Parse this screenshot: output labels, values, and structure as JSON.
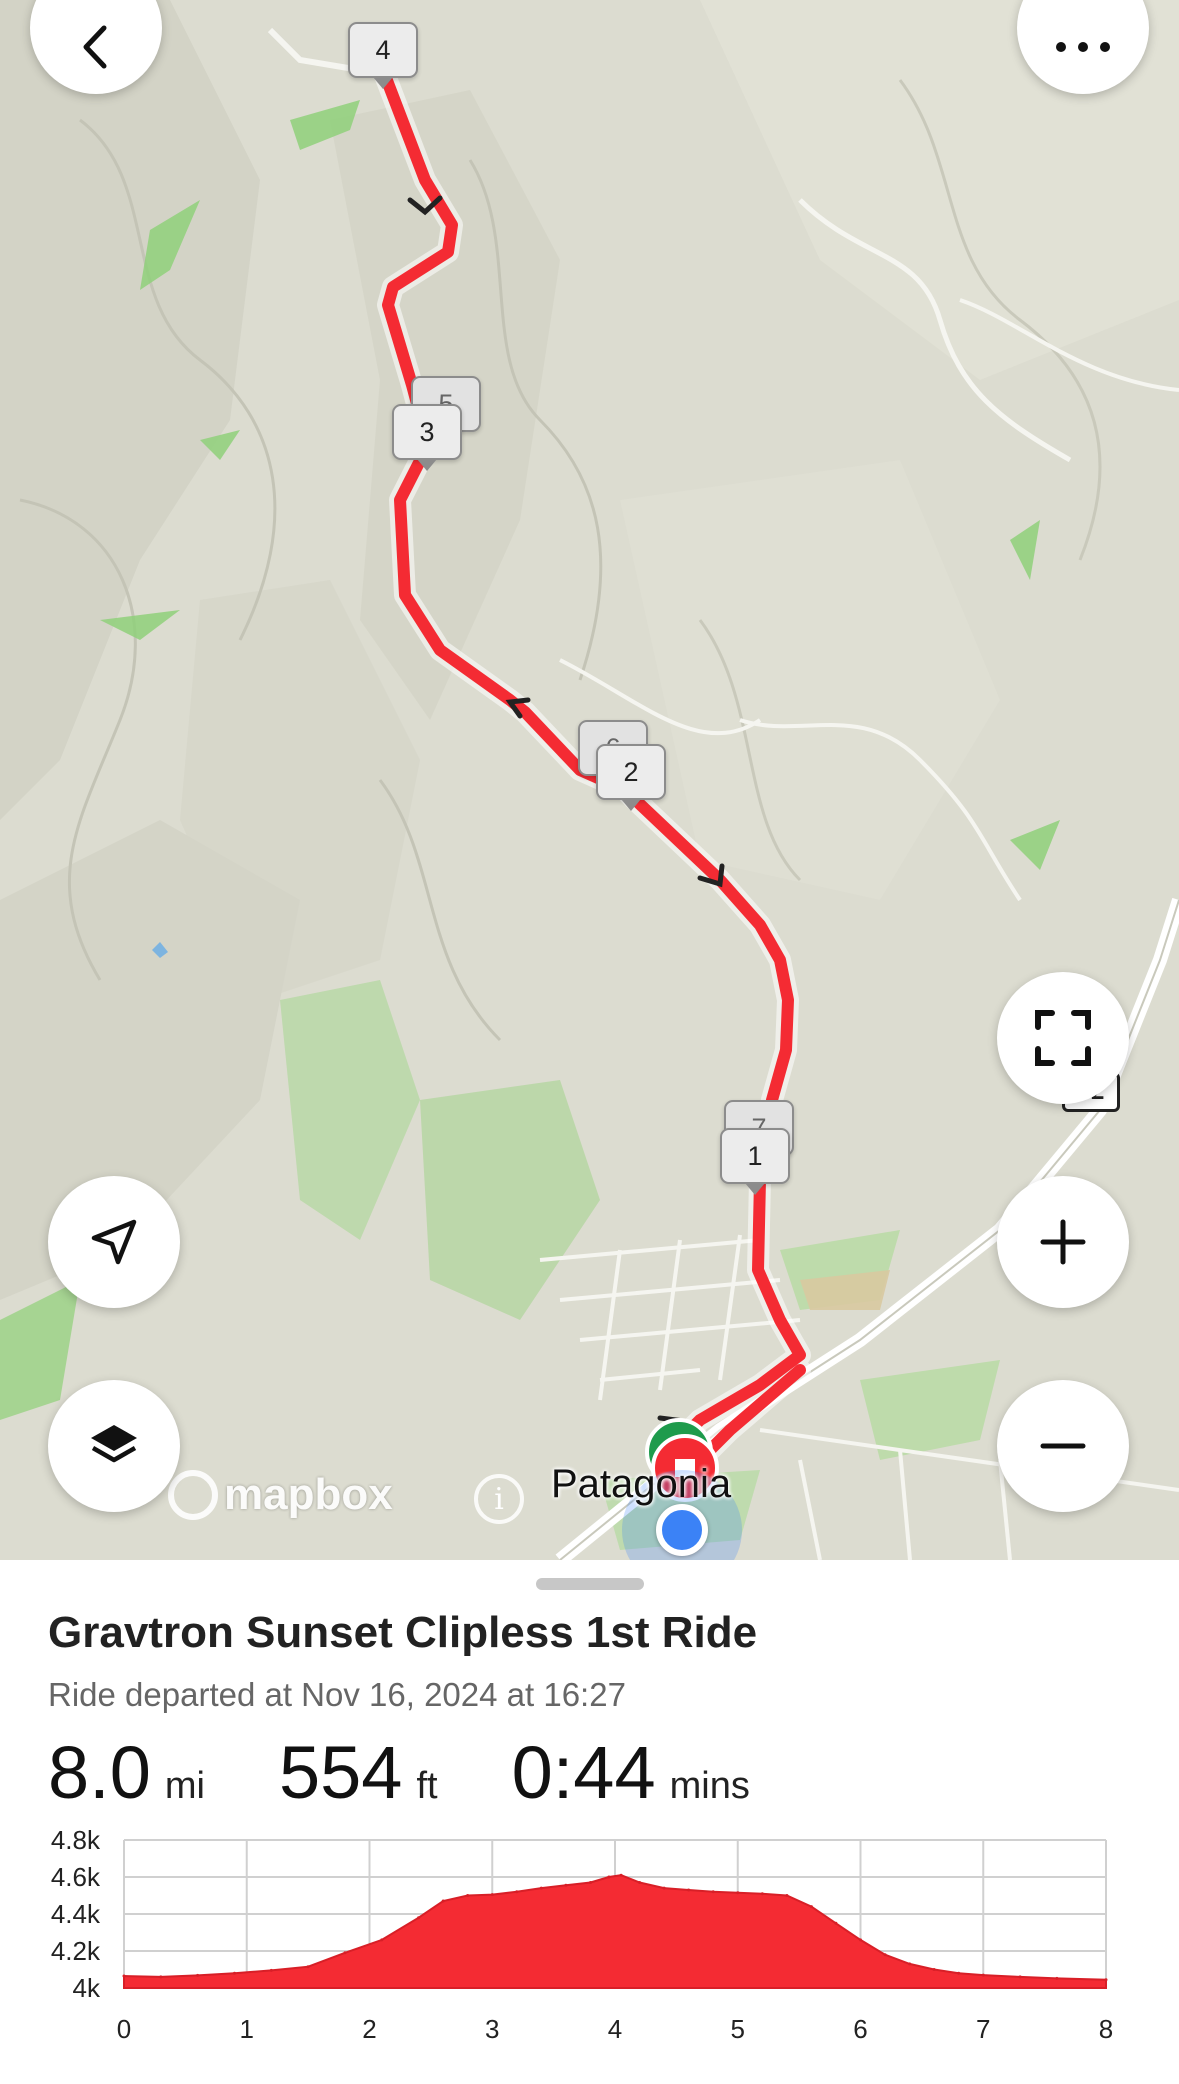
{
  "map": {
    "place_label": "Patagonia",
    "attribution_logo": "mapbox",
    "route_color": "#f42b33",
    "start_color": "#1e9b4c",
    "location_color": "#3b82f6",
    "route_markers": [
      {
        "label": "4"
      },
      {
        "label": "5"
      },
      {
        "label": "3"
      },
      {
        "label": "6"
      },
      {
        "label": "2"
      },
      {
        "label": "7"
      },
      {
        "label": "1"
      }
    ],
    "highway_shield": "82",
    "controls": {
      "back_icon": "chevron-left-icon",
      "more_icon": "ellipsis-icon",
      "fullscreen_icon": "expand-icon",
      "zoom_in_icon": "plus-icon",
      "zoom_out_icon": "minus-icon",
      "locate_icon": "navigation-arrow-icon",
      "layers_icon": "layers-icon",
      "info_icon": "info-icon"
    }
  },
  "ride": {
    "title": "Gravtron Sunset Clipless 1st Ride",
    "departed": "Ride departed at Nov 16, 2024 at 16:27",
    "stats": [
      {
        "value": "8.0",
        "unit": "mi"
      },
      {
        "value": "554",
        "unit": "ft"
      },
      {
        "value": "0:44",
        "unit": "mins"
      }
    ]
  },
  "chart_data": {
    "type": "area",
    "title": "",
    "xlabel": "",
    "ylabel": "",
    "x_ticks": [
      "0",
      "1",
      "2",
      "3",
      "4",
      "5",
      "6",
      "7",
      "8"
    ],
    "y_ticks": [
      "4k",
      "4.2k",
      "4.4k",
      "4.6k",
      "4.8k"
    ],
    "xlim": [
      0,
      8
    ],
    "ylim": [
      4000,
      4800
    ],
    "grid": true,
    "color": "#f42b33",
    "series": [
      {
        "x": [
          0,
          0.3,
          0.6,
          0.9,
          1.2,
          1.5,
          1.8,
          2.1,
          2.4,
          2.6,
          2.8,
          3.0,
          3.2,
          3.4,
          3.6,
          3.8,
          3.95,
          4.05,
          4.2,
          4.4,
          4.6,
          4.8,
          5.0,
          5.2,
          5.4,
          5.6,
          5.8,
          6.0,
          6.2,
          6.4,
          6.6,
          6.8,
          7.0,
          7.3,
          7.6,
          8.0
        ],
        "y": [
          4065,
          4060,
          4068,
          4080,
          4095,
          4115,
          4190,
          4260,
          4380,
          4470,
          4500,
          4505,
          4520,
          4540,
          4555,
          4570,
          4600,
          4610,
          4570,
          4540,
          4530,
          4520,
          4515,
          4510,
          4500,
          4440,
          4350,
          4260,
          4180,
          4130,
          4100,
          4080,
          4070,
          4060,
          4052,
          4045
        ]
      }
    ]
  }
}
